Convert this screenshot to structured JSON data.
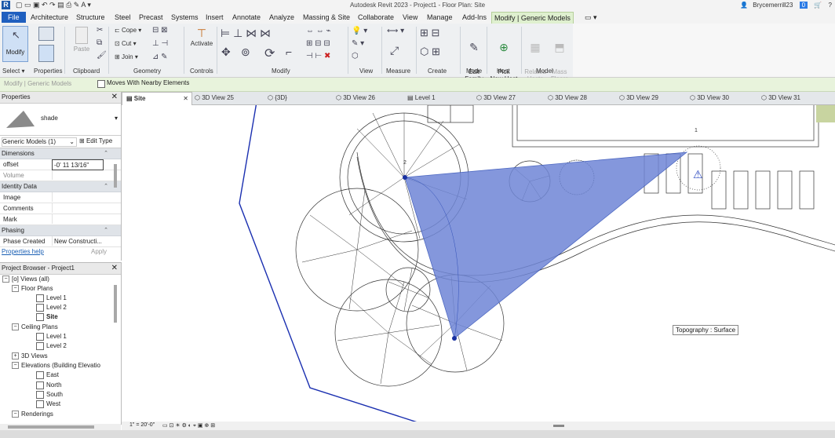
{
  "app": {
    "title": "Autodesk Revit 2023 - Project1 - Floor Plan: Site",
    "logo": "R",
    "user": "Brycemerrill23",
    "alert_count": "0",
    "help": "?"
  },
  "ribbon_tabs": [
    "File",
    "Architecture",
    "Structure",
    "Steel",
    "Precast",
    "Systems",
    "Insert",
    "Annotate",
    "Analyze",
    "Massing & Site",
    "Collaborate",
    "View",
    "Manage",
    "Add-Ins",
    "Modify | Generic Models"
  ],
  "ribbon": {
    "modify_label": "Modify",
    "paste_label": "Paste",
    "cope_label": "Cope",
    "cut_label": "Cut",
    "join_label": "Join",
    "activate_label": "Activate",
    "edit_family_label": "Edit\nFamily",
    "pick_new_host_label": "Pick\nNew Host",
    "related_hosts_label": "Related\nHosts",
    "mass_floors_label": "Mass\nFloors",
    "panels": [
      "Select",
      "Properties",
      "Clipboard",
      "Geometry",
      "Controls",
      "Modify",
      "View",
      "Measure",
      "Create",
      "Mode",
      "Host",
      "Model"
    ]
  },
  "options_bar": {
    "title": "Modify | Generic Models",
    "moves_with_nearby": "Moves With Nearby Elements"
  },
  "properties": {
    "header": "Properties",
    "type_name": "shade",
    "selector": "Generic Models (1)",
    "edit_type": "Edit Type",
    "sections": {
      "dimensions": "Dimensions",
      "identity": "Identity Data",
      "phasing": "Phasing"
    },
    "rows": {
      "offset_label": "offset",
      "offset_value": "-0'  11 13/16\"",
      "volume_label": "Volume",
      "image_label": "Image",
      "comments_label": "Comments",
      "mark_label": "Mark",
      "phase_created_label": "Phase Created",
      "phase_created_value": "New Constructi..."
    },
    "help_link": "Properties help",
    "apply": "Apply"
  },
  "browser": {
    "header": "Project Browser - Project1",
    "views_all": "Views (all)",
    "floor_plans": "Floor Plans",
    "fp_items": [
      "Level 1",
      "Level 2",
      "Site"
    ],
    "ceiling_plans": "Ceiling Plans",
    "cp_items": [
      "Level 1",
      "Level 2"
    ],
    "views_3d": "3D Views",
    "elevations": "Elevations (Building Elevatio",
    "elev_items": [
      "East",
      "North",
      "South",
      "West"
    ],
    "renderings": "Renderings"
  },
  "view_tabs": [
    "Site",
    "3D View 25",
    "{3D}",
    "3D View 26",
    "Level 1",
    "3D View 27",
    "3D View 28",
    "3D View 29",
    "3D View 30",
    "3D View 31"
  ],
  "canvas": {
    "tooltip": "Topography : Surface",
    "point_label_2": "2",
    "point_label_1": "1",
    "shade_color": "#6f86d6"
  },
  "view_control": {
    "scale": "1\" = 20'-0\""
  }
}
